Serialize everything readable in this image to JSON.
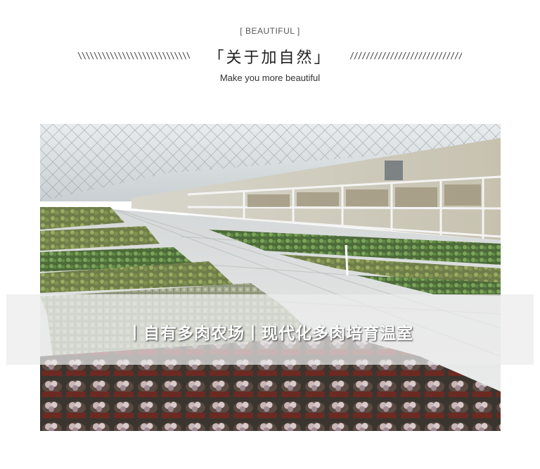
{
  "header": {
    "eyebrow": "[ BEAUTIFUL ]",
    "title": "「关于加自然」",
    "subtitle": "Make you more beautiful",
    "left_decoration": "\\\\\\\\\\\\\\\\\\\\\\\\\\\\\\\\\\\\\\\\\\\\\\\\\\\\\\\\\\\\\\\\\\",
    "right_decoration": "//////////////////////////////////"
  },
  "banner": {
    "caption": "丨自有多肉农场丨现代化多肉培育温室"
  },
  "colors": {
    "accent_text": "#222222",
    "band": "#ebebeb"
  }
}
